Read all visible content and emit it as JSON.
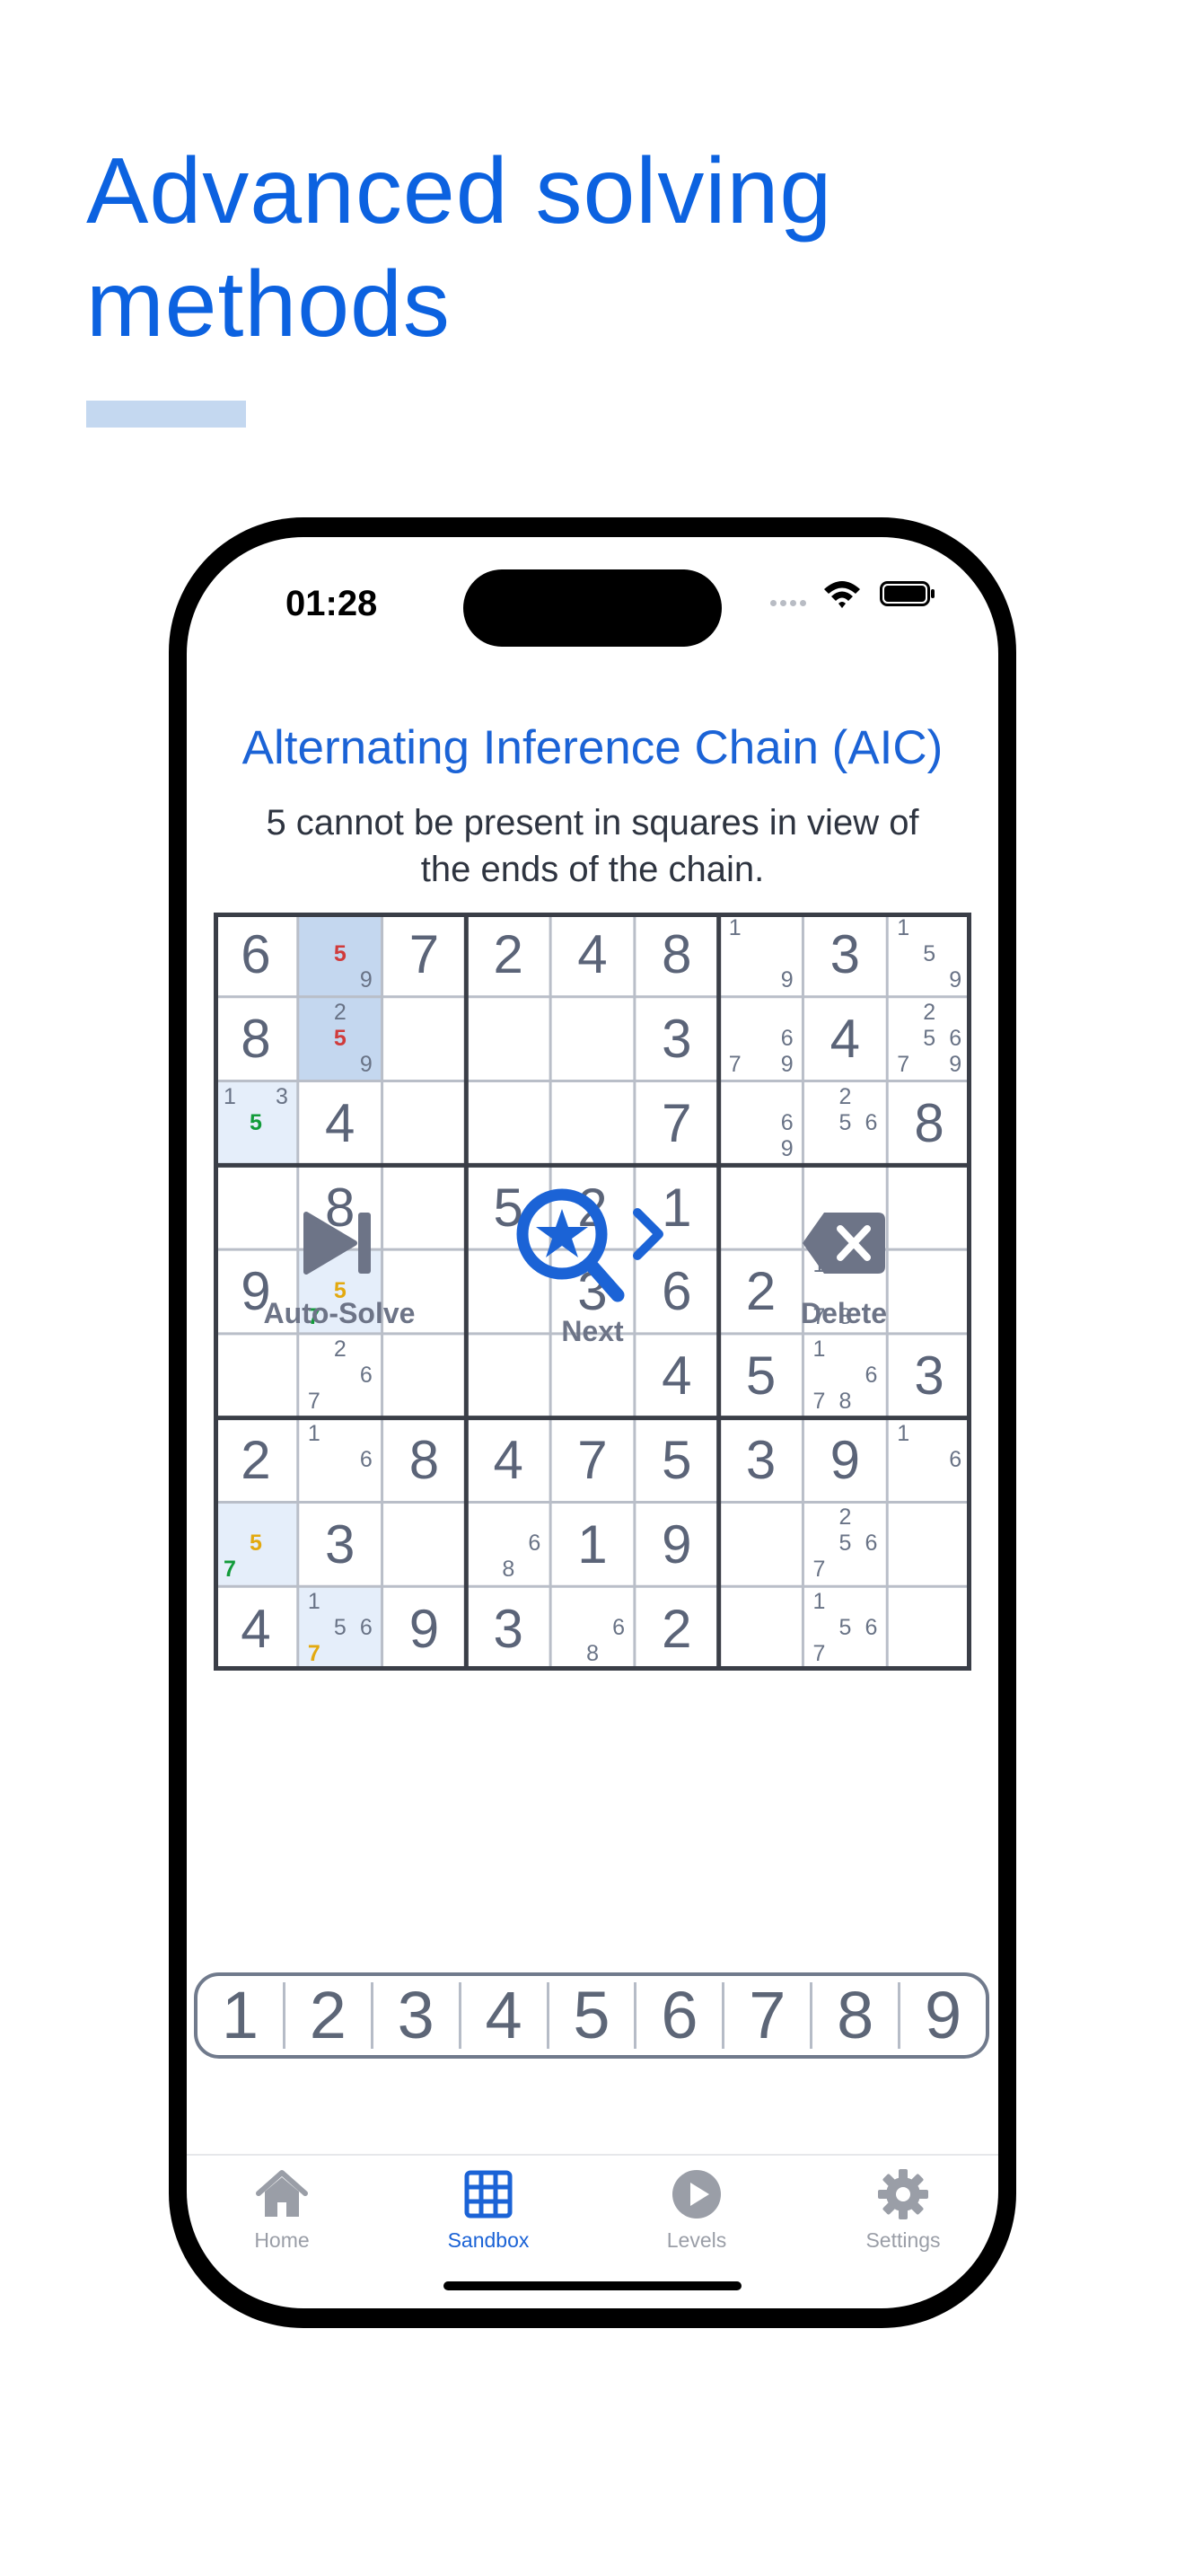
{
  "headline": "Advanced solving methods",
  "status_bar": {
    "time": "01:28"
  },
  "technique": {
    "title": "Alternating Inference Chain (AIC)",
    "description": "5 cannot be present in squares in view of the ends of the chain."
  },
  "board": {
    "values": [
      [
        6,
        0,
        7,
        2,
        4,
        8,
        0,
        3,
        0
      ],
      [
        8,
        0,
        0,
        0,
        0,
        3,
        0,
        4,
        0
      ],
      [
        0,
        4,
        0,
        0,
        0,
        7,
        0,
        0,
        8
      ],
      [
        0,
        8,
        0,
        5,
        2,
        1,
        0,
        0,
        0
      ],
      [
        9,
        0,
        0,
        0,
        3,
        6,
        2,
        0,
        0
      ],
      [
        0,
        0,
        0,
        0,
        0,
        4,
        5,
        0,
        3
      ],
      [
        2,
        0,
        8,
        4,
        7,
        5,
        3,
        9,
        0
      ],
      [
        0,
        3,
        0,
        0,
        1,
        9,
        0,
        0,
        0
      ],
      [
        4,
        0,
        9,
        3,
        0,
        2,
        0,
        0,
        0
      ]
    ],
    "highlights": [
      {
        "r": 0,
        "c": 1,
        "shade": "strong"
      },
      {
        "r": 1,
        "c": 1,
        "shade": "strong"
      },
      {
        "r": 2,
        "c": 0,
        "shade": "light"
      },
      {
        "r": 4,
        "c": 1,
        "shade": "light"
      },
      {
        "r": 7,
        "c": 0,
        "shade": "light"
      },
      {
        "r": 8,
        "c": 1,
        "shade": "light"
      }
    ],
    "notes": [
      {
        "r": 0,
        "c": 1,
        "digits": [
          {
            "d": 5,
            "color": "red"
          },
          {
            "d": 9
          }
        ]
      },
      {
        "r": 0,
        "c": 6,
        "digits": [
          {
            "d": 1
          },
          {
            "d": 9
          }
        ]
      },
      {
        "r": 0,
        "c": 8,
        "digits": [
          {
            "d": 1
          },
          {
            "d": 5
          },
          {
            "d": 9
          }
        ]
      },
      {
        "r": 1,
        "c": 1,
        "digits": [
          {
            "d": 2
          },
          {
            "d": 5,
            "color": "red"
          },
          {
            "d": 9
          }
        ]
      },
      {
        "r": 1,
        "c": 6,
        "digits": [
          {
            "d": 6
          },
          {
            "d": 7
          },
          {
            "d": 9
          }
        ]
      },
      {
        "r": 1,
        "c": 8,
        "digits": [
          {
            "d": 2
          },
          {
            "d": 5
          },
          {
            "d": 6
          },
          {
            "d": 7
          },
          {
            "d": 9
          }
        ]
      },
      {
        "r": 2,
        "c": 0,
        "digits": [
          {
            "d": 1
          },
          {
            "d": 3
          },
          {
            "d": 5,
            "color": "green"
          }
        ]
      },
      {
        "r": 2,
        "c": 6,
        "digits": [
          {
            "d": 6
          },
          {
            "d": 9
          }
        ]
      },
      {
        "r": 2,
        "c": 7,
        "digits": [
          {
            "d": 2
          },
          {
            "d": 5
          },
          {
            "d": 6
          }
        ]
      },
      {
        "r": 4,
        "c": 1,
        "digits": [
          {
            "d": 5,
            "color": "yellow"
          },
          {
            "d": 7,
            "color": "green"
          }
        ]
      },
      {
        "r": 4,
        "c": 7,
        "digits": [
          {
            "d": 1
          },
          {
            "d": 7
          },
          {
            "d": 8
          }
        ]
      },
      {
        "r": 5,
        "c": 1,
        "digits": [
          {
            "d": 2
          },
          {
            "d": 6
          },
          {
            "d": 7
          }
        ]
      },
      {
        "r": 5,
        "c": 7,
        "digits": [
          {
            "d": 1
          },
          {
            "d": 6
          },
          {
            "d": 7
          },
          {
            "d": 8
          }
        ]
      },
      {
        "r": 6,
        "c": 1,
        "digits": [
          {
            "d": 1
          },
          {
            "d": 6
          }
        ]
      },
      {
        "r": 6,
        "c": 8,
        "digits": [
          {
            "d": 1
          },
          {
            "d": 6
          }
        ]
      },
      {
        "r": 7,
        "c": 0,
        "digits": [
          {
            "d": 5,
            "color": "yellow"
          },
          {
            "d": 7,
            "color": "green"
          }
        ]
      },
      {
        "r": 7,
        "c": 3,
        "digits": [
          {
            "d": 6
          },
          {
            "d": 8
          }
        ]
      },
      {
        "r": 7,
        "c": 7,
        "digits": [
          {
            "d": 2
          },
          {
            "d": 5
          },
          {
            "d": 6
          },
          {
            "d": 7
          }
        ]
      },
      {
        "r": 8,
        "c": 1,
        "digits": [
          {
            "d": 1
          },
          {
            "d": 5
          },
          {
            "d": 6
          },
          {
            "d": 7,
            "color": "yellow"
          }
        ]
      },
      {
        "r": 8,
        "c": 4,
        "digits": [
          {
            "d": 6
          },
          {
            "d": 8
          }
        ]
      },
      {
        "r": 8,
        "c": 7,
        "digits": [
          {
            "d": 1
          },
          {
            "d": 5
          },
          {
            "d": 6
          },
          {
            "d": 7
          }
        ]
      }
    ]
  },
  "actions": {
    "autosolve": "Auto-Solve",
    "next": "Next",
    "delete": "Delete"
  },
  "numpad": [
    "1",
    "2",
    "3",
    "4",
    "5",
    "6",
    "7",
    "8",
    "9"
  ],
  "tabs": [
    {
      "label": "Home",
      "icon": "house-icon",
      "active": false
    },
    {
      "label": "Sandbox",
      "icon": "grid-icon",
      "active": true
    },
    {
      "label": "Levels",
      "icon": "play-icon",
      "active": false
    },
    {
      "label": "Settings",
      "icon": "gear-icon",
      "active": false
    }
  ],
  "colors": {
    "accent": "#0c62e0",
    "highlight_strong": "#c4d7ef",
    "highlight_light": "#e5eefa",
    "note_red": "#d03b3b",
    "note_green": "#129b3a",
    "note_yellow": "#e3a90f",
    "grid_thin": "#b9bec8",
    "grid_thick": "#3a3e47"
  }
}
